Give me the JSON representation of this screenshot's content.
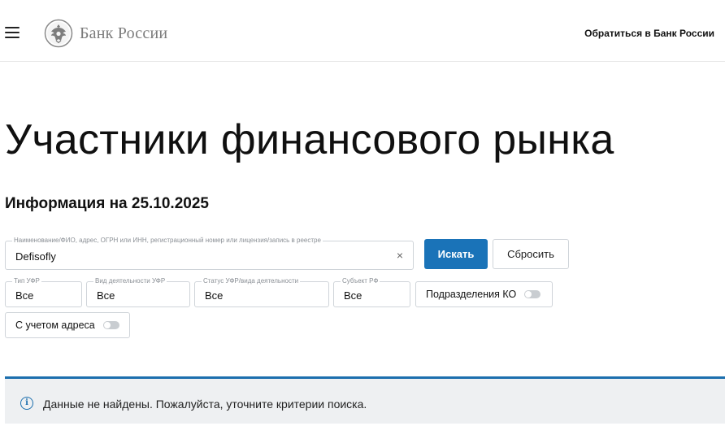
{
  "header": {
    "brand": "Банк России",
    "contact_link": "Обратиться в Банк России"
  },
  "page": {
    "title": "Участники финансового рынка",
    "info_date": "Информация на 25.10.2025"
  },
  "search": {
    "label": "Наименование/ФИО, адрес, ОГРН или ИНН, регистрационный номер или лицензия/запись в реестре",
    "value": "Defisofly",
    "clear_symbol": "×",
    "search_button": "Искать",
    "reset_button": "Сбросить"
  },
  "filters": {
    "type": {
      "label": "Тип УФР",
      "value": "Все"
    },
    "activity": {
      "label": "Вид деятельности УФР",
      "value": "Все"
    },
    "status": {
      "label": "Статус УФР/вида деятельности",
      "value": "Все"
    },
    "subject": {
      "label": "Субъект РФ",
      "value": "Все"
    },
    "ko_divisions": {
      "label": "Подразделения КО",
      "enabled": false
    },
    "with_address": {
      "label": "С учетом адреса",
      "enabled": false
    }
  },
  "notice": {
    "icon": "info-icon",
    "text": "Данные не найдены. Пожалуйста, уточните критерии поиска."
  },
  "colors": {
    "accent": "#1a73b8",
    "notice_border": "#1c6fae",
    "notice_bg": "#eef0f2"
  }
}
